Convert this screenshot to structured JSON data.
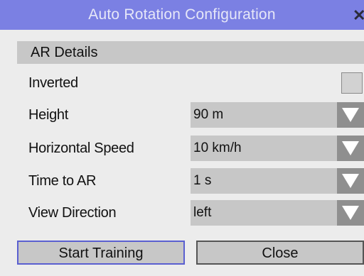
{
  "window": {
    "title": "Auto Rotation Configuration"
  },
  "section": {
    "title": "AR Details"
  },
  "fields": {
    "inverted": {
      "label": "Inverted",
      "checked": false
    },
    "height": {
      "label": "Height",
      "value": "90 m"
    },
    "horizontal_speed": {
      "label": "Horizontal Speed",
      "value": "10 km/h"
    },
    "time_to_ar": {
      "label": "Time to AR",
      "value": "1 s"
    },
    "view_direction": {
      "label": "View Direction",
      "value": "left"
    }
  },
  "buttons": {
    "start_training": "Start Training",
    "close": "Close"
  },
  "colors": {
    "titlebar": "#7b80e3",
    "background": "#ececec",
    "control": "#c7c7c7",
    "arrow_box": "#8f8f8f",
    "focus_border": "#5a5fd0"
  }
}
